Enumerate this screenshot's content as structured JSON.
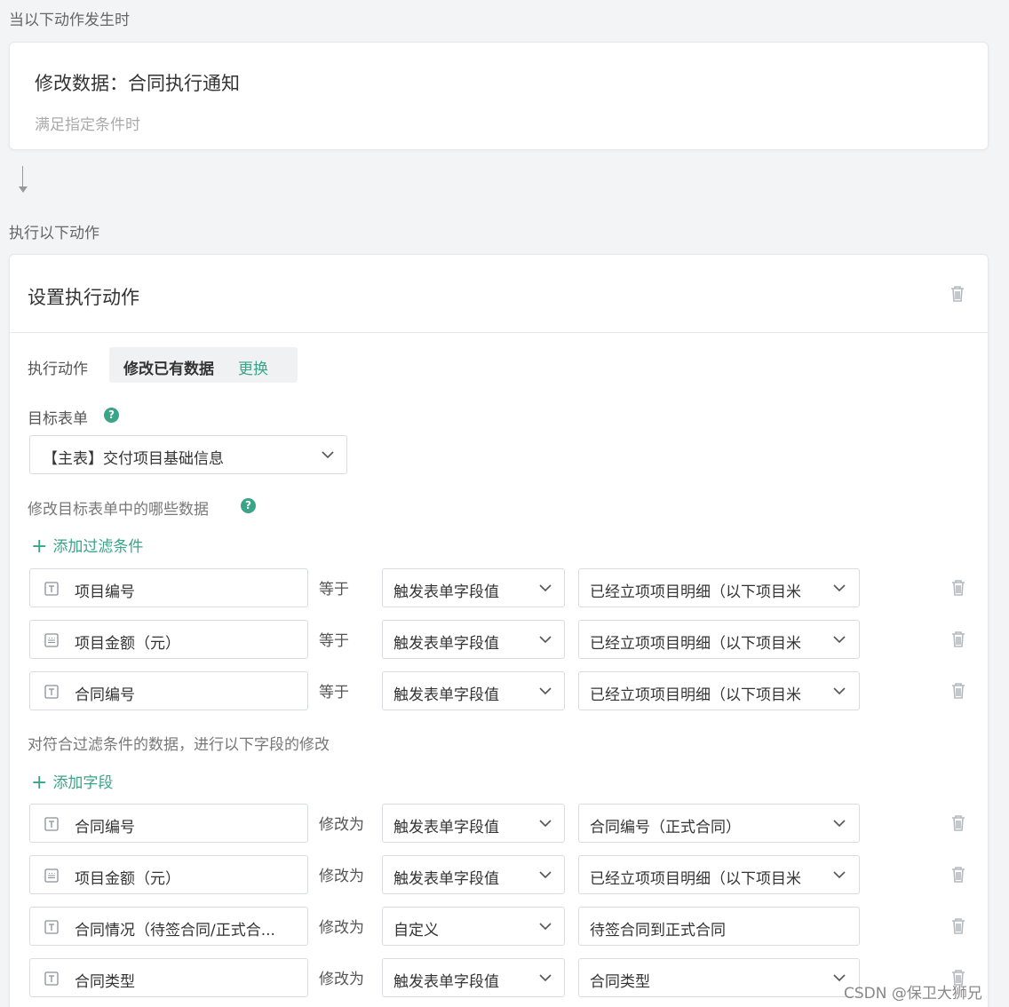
{
  "trigger": {
    "section_label": "当以下动作发生时",
    "title": "修改数据：合同执行通知",
    "subtitle": "满足指定条件时"
  },
  "action_section": {
    "section_label": "执行以下动作",
    "card_title": "设置执行动作",
    "action_row_label": "执行动作",
    "action_value": "修改已有数据",
    "action_change_link": "更换",
    "target_form_label": "目标表单",
    "target_form_value": "【主表】交付项目基础信息",
    "filter_section_label": "修改目标表单中的哪些数据",
    "add_filter_link": "添加过滤条件",
    "filters": [
      {
        "field": "项目编号",
        "field_icon": "text-field-icon",
        "operator": "等于",
        "source": "触发表单字段值",
        "value": "已经立项项目明细（以下项目米"
      },
      {
        "field": "项目金额（元）",
        "field_icon": "number-field-icon",
        "operator": "等于",
        "source": "触发表单字段值",
        "value": "已经立项项目明细（以下项目米"
      },
      {
        "field": "合同编号",
        "field_icon": "text-field-icon",
        "operator": "等于",
        "source": "触发表单字段值",
        "value": "已经立项项目明细（以下项目米"
      }
    ],
    "update_section_label": "对符合过滤条件的数据，进行以下字段的修改",
    "add_field_link": "添加字段",
    "updates": [
      {
        "field": "合同编号",
        "field_icon": "text-field-icon",
        "operator": "修改为",
        "source": "触发表单字段值",
        "value": "合同编号（正式合同）"
      },
      {
        "field": "项目金额（元）",
        "field_icon": "number-field-icon",
        "operator": "修改为",
        "source": "触发表单字段值",
        "value": "已经立项项目明细（以下项目米"
      },
      {
        "field": "合同情况（待签合同/正式合...",
        "field_icon": "text-field-icon",
        "operator": "修改为",
        "source": "自定义",
        "value": "待签合同到正式合同"
      },
      {
        "field": "合同类型",
        "field_icon": "text-field-icon",
        "operator": "修改为",
        "source": "触发表单字段值",
        "value": "合同类型"
      }
    ]
  },
  "watermark": "CSDN @保卫大狮兄",
  "colors": {
    "accent": "#3aa488",
    "border": "#d9dce0",
    "background": "#f3f4f6"
  }
}
